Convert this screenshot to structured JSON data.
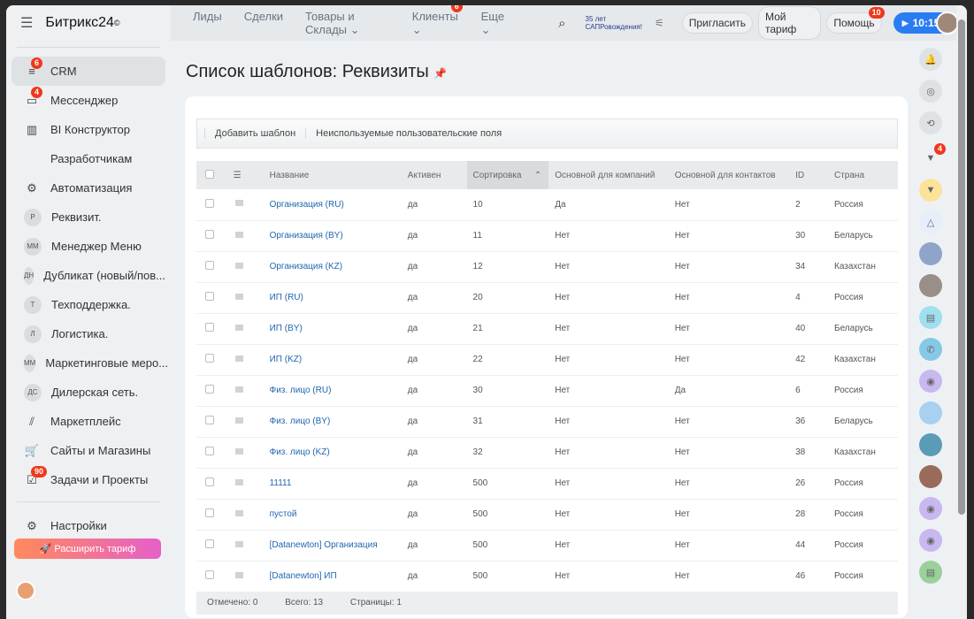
{
  "app": {
    "name": "Битрикс24",
    "logo_suffix": "©"
  },
  "sidebar": {
    "items": [
      {
        "label": "CRM",
        "icon": "filter-icon",
        "badge": "6",
        "active": true
      },
      {
        "label": "Мессенджер",
        "icon": "chat-icon",
        "badge": "4"
      },
      {
        "label": "BI Конструктор",
        "icon": "bar-chart-icon"
      },
      {
        "label": "Разработчикам",
        "icon": "code-icon"
      },
      {
        "label": "Автоматизация",
        "icon": "robot-icon"
      },
      {
        "label": "Реквизит.",
        "initials": "Р"
      },
      {
        "label": "Менеджер Меню",
        "initials": "ММ"
      },
      {
        "label": "Дубликат (новый/пов...",
        "initials": "ДН"
      },
      {
        "label": "Техподдержка.",
        "initials": "Т"
      },
      {
        "label": "Логистика.",
        "initials": "Л"
      },
      {
        "label": "Маркетинговые меро...",
        "initials": "ММ"
      },
      {
        "label": "Дилерская сеть.",
        "initials": "ДС"
      },
      {
        "label": "Маркетплейс",
        "icon": "marketplace-icon"
      },
      {
        "label": "Сайты и Магазины",
        "icon": "cart-icon"
      },
      {
        "label": "Задачи и Проекты",
        "icon": "tasks-icon",
        "badge": "90"
      }
    ],
    "settings": "Настройки",
    "upgrade": "Расширить тариф"
  },
  "topbar": {
    "menu": [
      {
        "label": "Лиды"
      },
      {
        "label": "Сделки"
      },
      {
        "label": "Товары и Склады ⌄"
      },
      {
        "label": "Клиенты ⌄",
        "badge": "6"
      },
      {
        "label": "Еще ⌄"
      }
    ],
    "logo_text": "35 лет САПРовождения!",
    "invite": "Пригласить",
    "tariff": "Мой тариф",
    "help": "Помощь",
    "help_badge": "10",
    "time": "10:15"
  },
  "page": {
    "title": "Список шаблонов: Реквизиты"
  },
  "toolbar": {
    "add": "Добавить шаблон",
    "unused": "Неиспользуемые пользовательские поля"
  },
  "table": {
    "columns": [
      "Название",
      "Активен",
      "Сортировка",
      "Основной для компаний",
      "Основной для контактов",
      "ID",
      "Страна"
    ],
    "rows": [
      [
        "Организация (RU)",
        "да",
        "10",
        "Да",
        "Нет",
        "2",
        "Россия"
      ],
      [
        "Организация (BY)",
        "да",
        "11",
        "Нет",
        "Нет",
        "30",
        "Беларусь"
      ],
      [
        "Организация (KZ)",
        "да",
        "12",
        "Нет",
        "Нет",
        "34",
        "Казахстан"
      ],
      [
        "ИП (RU)",
        "да",
        "20",
        "Нет",
        "Нет",
        "4",
        "Россия"
      ],
      [
        "ИП (BY)",
        "да",
        "21",
        "Нет",
        "Нет",
        "40",
        "Беларусь"
      ],
      [
        "ИП (KZ)",
        "да",
        "22",
        "Нет",
        "Нет",
        "42",
        "Казахстан"
      ],
      [
        "Физ. лицо (RU)",
        "да",
        "30",
        "Нет",
        "Да",
        "6",
        "Россия"
      ],
      [
        "Физ. лицо (BY)",
        "да",
        "31",
        "Нет",
        "Нет",
        "36",
        "Беларусь"
      ],
      [
        "Физ. лицо (KZ)",
        "да",
        "32",
        "Нет",
        "Нет",
        "38",
        "Казахстан"
      ],
      [
        "11111",
        "да",
        "500",
        "Нет",
        "Нет",
        "26",
        "Россия"
      ],
      [
        "пустой",
        "да",
        "500",
        "Нет",
        "Нет",
        "28",
        "Россия"
      ],
      [
        "[Datanewton] Организация",
        "да",
        "500",
        "Нет",
        "Нет",
        "44",
        "Россия"
      ],
      [
        "[Datanewton] ИП",
        "да",
        "500",
        "Нет",
        "Нет",
        "46",
        "Россия"
      ]
    ]
  },
  "footer": {
    "selected": "Отмечено: 0",
    "total": "Всего: 13",
    "pages": "Страницы:  1"
  },
  "right_panel": {
    "badge": "4"
  }
}
